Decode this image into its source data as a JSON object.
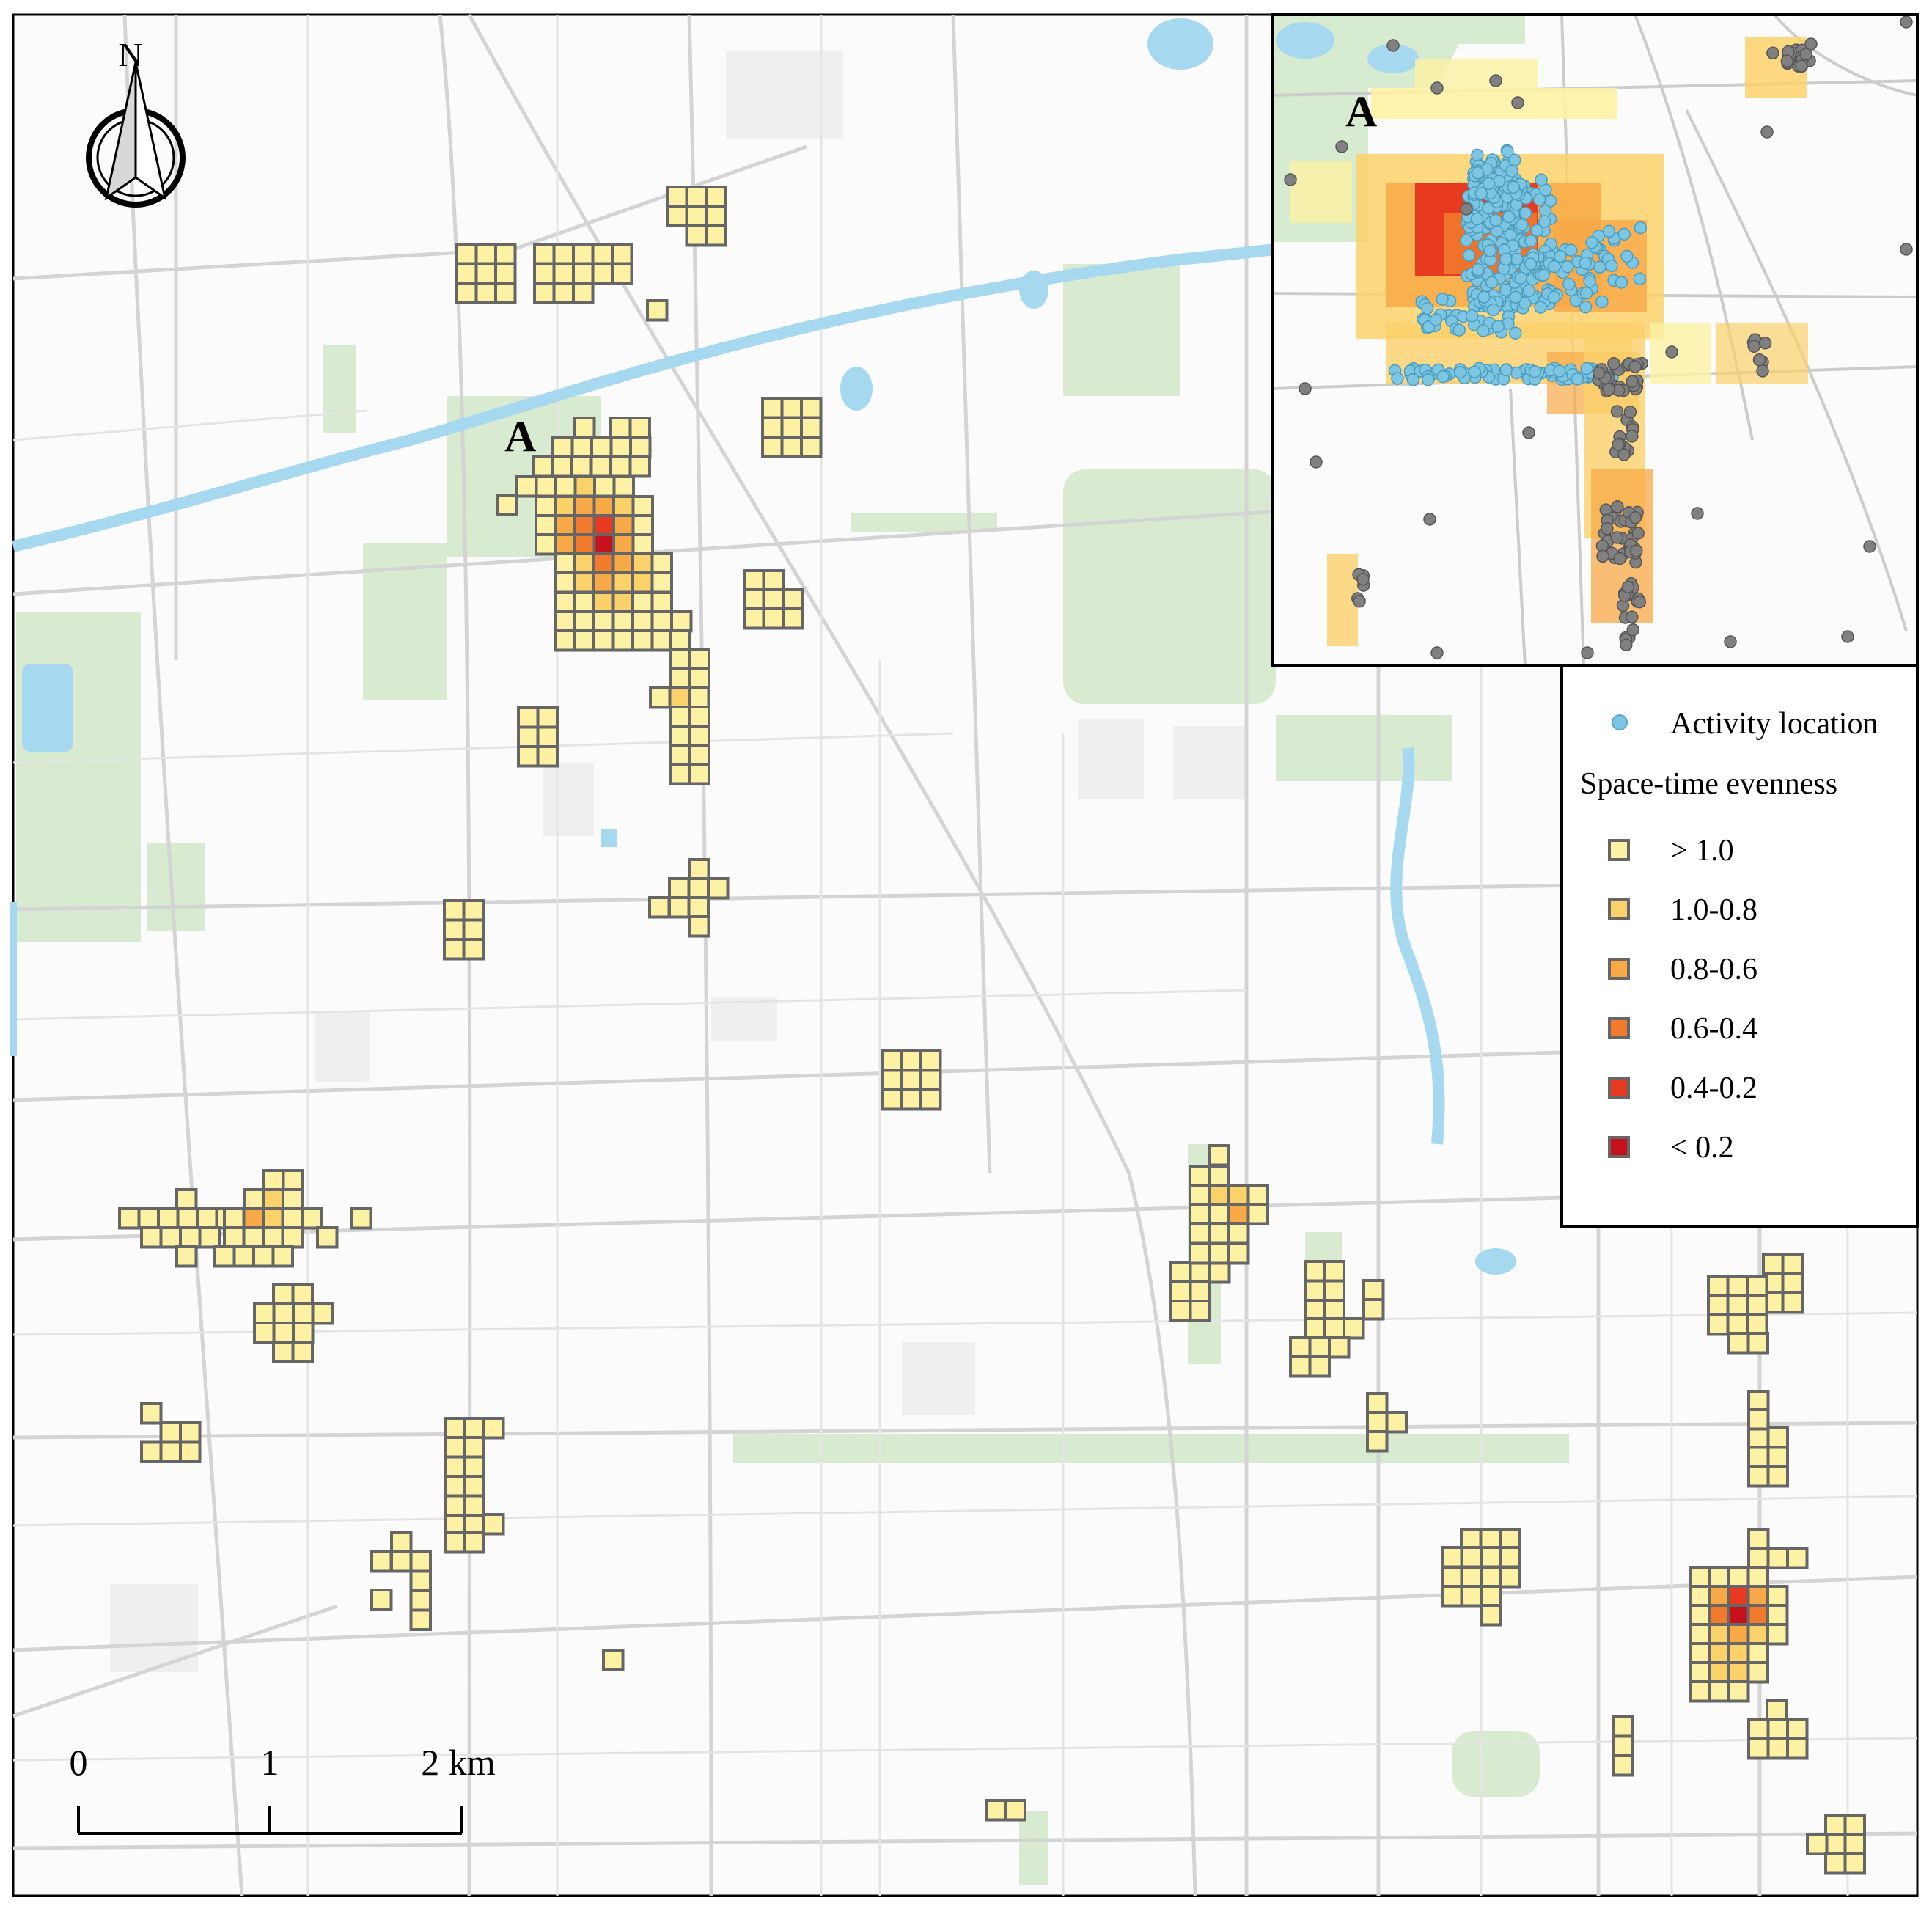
{
  "map": {
    "main_label": "A",
    "north_label": "N"
  },
  "inset": {
    "label": "A"
  },
  "legend": {
    "activity_label": "Activity location",
    "heading": "Space-time evenness",
    "classes": [
      {
        "label": "> 1.0",
        "color": "#fdf2a4"
      },
      {
        "label": "1.0-0.8",
        "color": "#fbd16a"
      },
      {
        "label": "0.8-0.6",
        "color": "#f8a947"
      },
      {
        "label": "0.6-0.4",
        "color": "#f27a2c"
      },
      {
        "label": "0.4-0.2",
        "color": "#e83a21"
      },
      {
        "label": "< 0.2",
        "color": "#c8101d"
      }
    ]
  },
  "scalebar": {
    "ticks": [
      "0",
      "1",
      "2 km"
    ]
  },
  "colors": {
    "cell_outline": "#666666",
    "activity_point": "#7cc6e4",
    "other_point": "#808080",
    "water": "#a6d8f0",
    "green": "#d6ebcf",
    "road": "#d6d6d6"
  }
}
